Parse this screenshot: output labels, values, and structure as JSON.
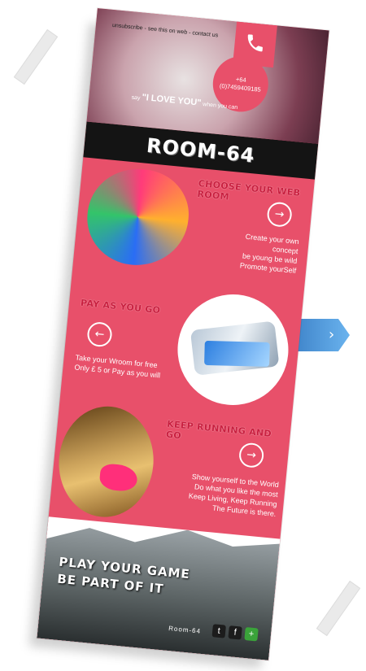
{
  "header": {
    "links": [
      "unsubscribe",
      "see this on web",
      "contact us"
    ],
    "separator": " - ",
    "phone_line1": "+64",
    "phone_line2": "(0)7459409185",
    "tagline_pre": "say",
    "tagline_main": "\"I LOVE YOU\"",
    "tagline_post": "when you can"
  },
  "logo": "ROOM-64",
  "sections": [
    {
      "title": "CHOOSE YOUR WEB ROOM",
      "lines": [
        "Create your own concept",
        "be young be wild",
        "Promote yourSelf"
      ],
      "arrow": "right"
    },
    {
      "title": "PAY AS YOU GO",
      "lines": [
        "Take your Wroom for free",
        "Only £ 5 or Pay as you will"
      ],
      "arrow": "left"
    },
    {
      "title": "KEEP RUNNING AND GO",
      "lines": [
        "Show yourself to the World",
        "Do what you like the most",
        "Keep Living, Keep Running",
        "The Future is there."
      ],
      "arrow": "right"
    }
  ],
  "footer": {
    "line1": "PLAY YOUR GAME",
    "line2": "BE PART OF IT",
    "brand": "Room-64"
  },
  "icons": {
    "phone": "phone-icon",
    "twitter": "twitter-icon",
    "facebook": "facebook-icon",
    "share": "share-icon"
  },
  "colors": {
    "accent": "#e8506a",
    "title": "#c91f3f",
    "logo_bar": "#141414"
  }
}
